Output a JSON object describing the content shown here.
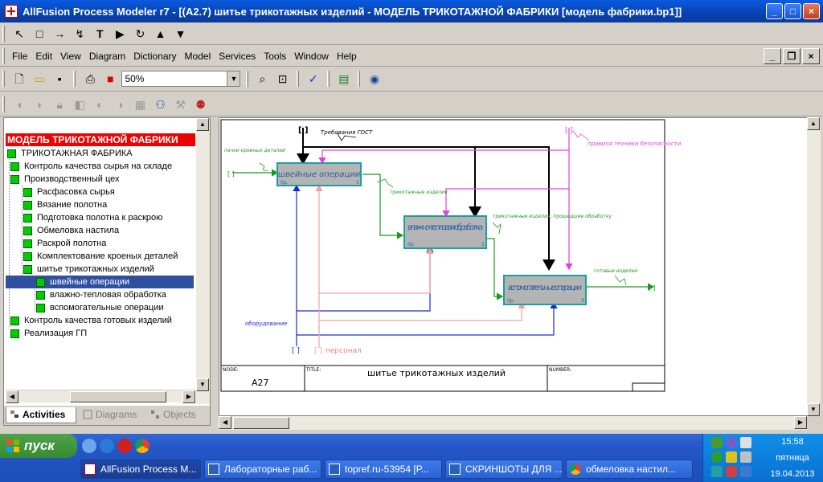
{
  "window": {
    "title": "AllFusion Process Modeler r7 - [(A2.7) шитье  трикотажных  изделий - МОДЕЛЬ ТРИКОТАЖНОЙ ФАБРИКИ  [модель фабрики.bp1]]"
  },
  "menu": {
    "items": [
      "File",
      "Edit",
      "View",
      "Diagram",
      "Dictionary",
      "Model",
      "Services",
      "Tools",
      "Window",
      "Help"
    ]
  },
  "toolbar": {
    "zoom_value": "50%"
  },
  "tree": {
    "root": "МОДЕЛЬ ТРИКОТАЖНОЙ ФАБРИКИ",
    "items": [
      "ТРИКОТАЖНАЯ ФАБРИКА",
      "Контроль качества  сырья на складе",
      "Производственный цех",
      "Расфасовка  сырья",
      "Вязание  полотна",
      "Подготовка  полотна  к раскрою",
      "Обмеловка  настила",
      "Раскрой полотна",
      "Комплектование  кроеных    деталей",
      "шитье  трикотажных  изделий",
      "швейные  операции",
      "влажно-тепловая     обработка",
      "вспомогательные    операции",
      "Контроль качества  готовых изделий",
      "Реализация  ГП"
    ]
  },
  "tabs": [
    "Activities",
    "Diagrams",
    "Objects"
  ],
  "diagram": {
    "box1": "швейные  операции",
    "box2": "влажно-тепловая обработка",
    "box3": "вспомогательные операции",
    "box_small_left": "0р.",
    "box1_num": "1",
    "box2_num": "2",
    "box3_num": "3",
    "arrow_control1": "Требования ГОСТ",
    "arrow_control2": "правила техники безопасности",
    "arrow_input": "пачки кроеных деталей",
    "arrow_12": "трикотажные изделия",
    "arrow_23": "трикотажные изделия, прошедшие обработку",
    "arrow_output": "готовые изделия",
    "arrow_mech1": "оборудование",
    "arrow_mech2": "персонал",
    "frame_node_label": "NODE:",
    "frame_node_value": "A27",
    "frame_title_label": "TITLE:",
    "frame_title_value": "шитье  трикотажных  изделий",
    "frame_number_label": "NUMBER:"
  },
  "taskbar": {
    "start": "пуск",
    "tasks": [
      "AllFusion Process M...",
      "Лабораторные раб...",
      "topref.ru-53954 [Р...",
      "СКРИНШОТЫ ДЛЯ ...",
      "обмеловка настил..."
    ],
    "time": "15:58",
    "day": "пятница",
    "date": "19.04.2013"
  },
  "colors": {
    "title_bar": "#0a5be0",
    "tree_root_bg": "#ff0000",
    "selected_bg": "#2f4f9f",
    "box_fill": "#b4b4b4",
    "box_border": "#1aa0a0",
    "control_black": "#000000",
    "control_magenta": "#e040e0",
    "input_green": "#1a9a1a",
    "mech_blue": "#1a2ad0",
    "mech_pink": "#f0a0a0"
  }
}
